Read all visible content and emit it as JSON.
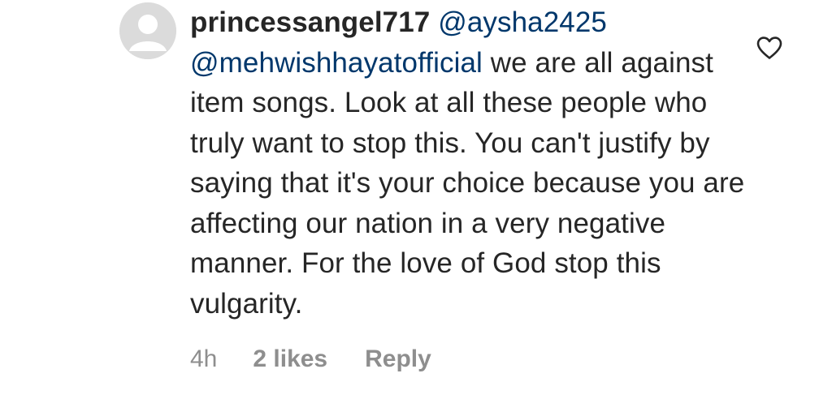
{
  "comment": {
    "avatar_icon": "default-avatar-icon",
    "username": "princessangel717",
    "mentions": [
      "@aysha2425",
      "@mehwishhayatofficial"
    ],
    "text": "we are all against item songs. Look at all these people who truly want to stop this. You can't justify by saying that it's your choice because you are affecting our nation in a very negative manner. For the love of God stop this vulgarity.",
    "like_icon": "heart-outline-icon"
  },
  "meta": {
    "time": "4h",
    "likes": "2 likes",
    "reply_label": "Reply"
  },
  "colors": {
    "text": "#262626",
    "mention": "#00376b",
    "secondary": "#8e8e8e",
    "avatar_bg": "#dbdbdb"
  }
}
